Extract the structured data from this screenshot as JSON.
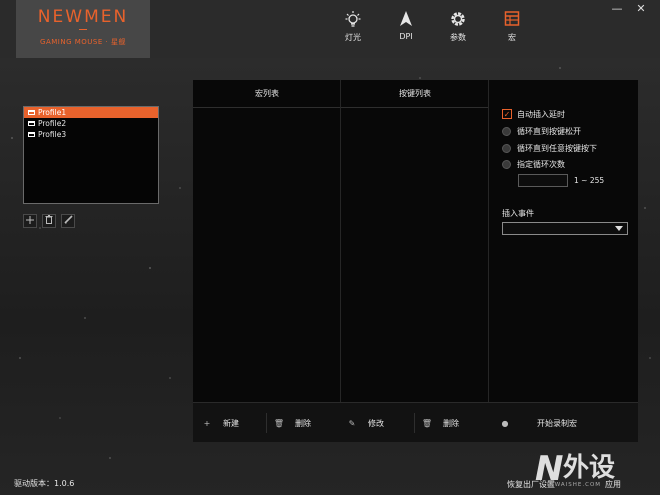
{
  "header": {
    "logo": "NEWMEN",
    "logo_sub": "GAMING MOUSE · 星舰",
    "nav": [
      {
        "label": "灯光",
        "icon": "bulb-icon"
      },
      {
        "label": "DPI",
        "icon": "arrow-cursor-icon"
      },
      {
        "label": "参数",
        "icon": "gear-icon"
      },
      {
        "label": "宏",
        "icon": "grid-table-icon"
      }
    ],
    "window": {
      "minimize": "—",
      "close": "✕"
    }
  },
  "profiles": {
    "items": [
      {
        "label": "Profile1",
        "active": true
      },
      {
        "label": "Profile2",
        "active": false
      },
      {
        "label": "Profile3",
        "active": false
      }
    ],
    "tools": [
      "plus-icon",
      "trash-icon",
      "pencil-icon"
    ]
  },
  "macro": {
    "list_header": "宏列表",
    "keys_header": "按键列表",
    "buttons": {
      "new": "新建",
      "delete_macro": "删除",
      "modify": "修改",
      "delete_key": "删除",
      "record": "开始录制宏"
    }
  },
  "options": {
    "auto_delay": {
      "label": "自动插入延时",
      "checked": true
    },
    "loop_until_release": "循环直到按键松开",
    "loop_until_any": "循环直到任意按键按下",
    "loop_count": "指定循环次数",
    "range": "1 ~ 255",
    "insert_event_label": "插入事件",
    "insert_event_value": ""
  },
  "footer": {
    "version": "驱动版本：1.0.6",
    "reset": "恢复出厂设置",
    "apply": "应用",
    "watermark": "INWAISHE.COM"
  },
  "colors": {
    "accent": "#e8622c",
    "background": "#2a2a2a",
    "panel": "#080808"
  }
}
